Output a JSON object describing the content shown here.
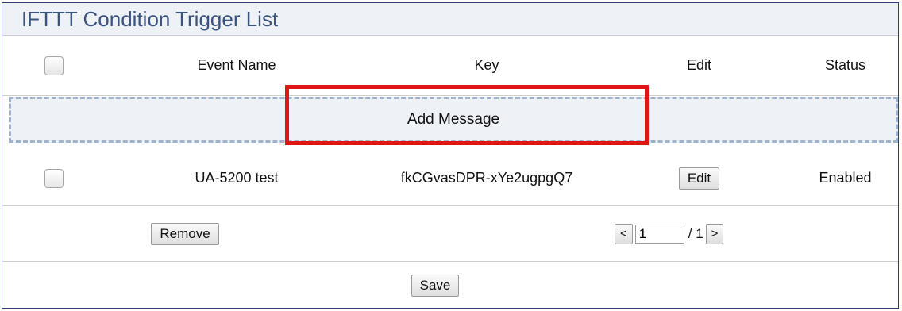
{
  "title": "IFTTT Condition Trigger List",
  "table": {
    "headers": {
      "event_name": "Event Name",
      "key": "Key",
      "edit": "Edit",
      "status": "Status"
    },
    "add_message_label": "Add Message",
    "rows": [
      {
        "event_name": "UA-5200 test",
        "key": "fkCGvasDPR-xYe2ugpgQ7",
        "edit_label": "Edit",
        "status": "Enabled"
      }
    ]
  },
  "footer": {
    "remove_label": "Remove",
    "pager": {
      "prev_label": "<",
      "page_value": "1",
      "total": "/ 1",
      "next_label": ">"
    },
    "save_label": "Save"
  },
  "colors": {
    "title_text": "#3a547f",
    "panel_border": "#2c3e73",
    "highlight": "#e01616",
    "add_area_border": "#9fb3cf"
  }
}
